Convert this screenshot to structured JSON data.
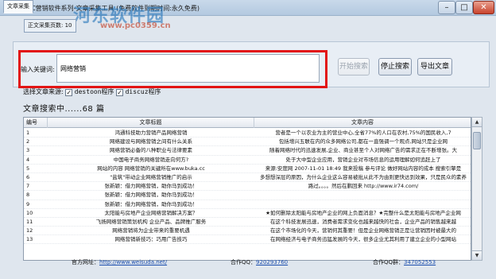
{
  "window": {
    "title": "SKYCC营销软件系列-文章采集工具 (免费软件到期时间:永久免费)",
    "minimize_glyph": "–",
    "maximize_glyph": "□",
    "close_glyph": "✕"
  },
  "watermark": {
    "text": "河东软件园",
    "url": "www.pc0359.cn"
  },
  "tabs": [
    {
      "label": "文章采集"
    },
    {
      "label": "正文采集页数: 10"
    }
  ],
  "keyword": {
    "label": "输入关键词:",
    "value": "网络营销"
  },
  "buttons": {
    "start": "开始搜索",
    "stop": "停止搜索",
    "export": "导出文章"
  },
  "source": {
    "label": "选择文章来源:",
    "options": [
      {
        "label": "destoon程序",
        "checked": true
      },
      {
        "label": "discuz程序",
        "checked": true
      }
    ],
    "check_glyph": "✓"
  },
  "status": "文章搜索中......68 篇",
  "table": {
    "columns": [
      "编号",
      "文章标题",
      "文章内容"
    ],
    "rows": [
      {
        "no": "1",
        "title": "鸿通科技助力营销产品网络营销",
        "content": "营者是一个以农业为主的营业中心,全省77%的人口在农村,75%的国民收入,7"
      },
      {
        "no": "2",
        "title": "网络建设与网络营销之间有什么关系",
        "content": "包括增兴五联在内的众多网络公司,都在一直强调一个观点,网站只是企业网"
      },
      {
        "no": "3",
        "title": "网络营销必备的八种职业与法律要素",
        "content": "随着网络时代的迅速发展,企业、商业甚至个人对网络广告的需求正在不断增张。大"
      },
      {
        "no": "4",
        "title": "中国电子商务网络营销走向何方?",
        "content": "处于大中型企业应用，营销企业对市场信息的运用理解如何追赶上了"
      },
      {
        "no": "5",
        "title": "网站的内容 网络营销的关键所在www.buka.cc",
        "content": "来源:安度网 2007-11-01 18:49 我来投稿 参与评论 做好网站内容的成本 搜索引擎是"
      },
      {
        "no": "6",
        "title": "\"盐筑\"带动企业网络营销推广的启示",
        "content": "多想想深层的原因，为什么企业这么容易被批从此不为由则更快达到效果，只是民众的素养"
      },
      {
        "no": "7",
        "title": "张新颖：借力网络营销，助你马到成功！",
        "content": "路过。。。。然后在鹏回来 http://www.ir74.com/"
      },
      {
        "no": "8",
        "title": "张新颖：借力网络营销，助你马到成功！",
        "content": ""
      },
      {
        "no": "9",
        "title": "张新颖：借力网络营销，助你马到成功！",
        "content": ""
      },
      {
        "no": "10",
        "title": "太阳能与房地产企业网络营销解决方案？",
        "content": "★如何删除太阳能与房地产企业的网上负面消息？★完整什么是太阳能与房地产企业网"
      },
      {
        "no": "11",
        "title": "飞扬网络营销策划机构 企业产品、品牌推广服务",
        "content": "在这个科技发展迅速，消费者需求变化也越来越快的社会，企业产品的销售越来越"
      },
      {
        "no": "12",
        "title": "网络营销将为企业带来的重要机遇",
        "content": "在这个市场化的今天，营销何其重要！但是企业网络营销正是让营销因时被最大的"
      },
      {
        "no": "13",
        "title": "网络营销新技巧：巧用广告技巧",
        "content": "在网络经济与电子商务迅猛发展的今天，很多企业尤其利用了建立企业的小型网站"
      }
    ]
  },
  "footer": {
    "site_label": "官方网址：",
    "site_url": "http://www.weisuda.net/",
    "qq_label": "合作QQ：",
    "qq_value": "920293760",
    "group_label": "合作QQ群：",
    "group_value": "347052553"
  },
  "colors": {
    "highlight": "#e21414",
    "link": "#1d4fae",
    "watermark": "#2676ba"
  }
}
